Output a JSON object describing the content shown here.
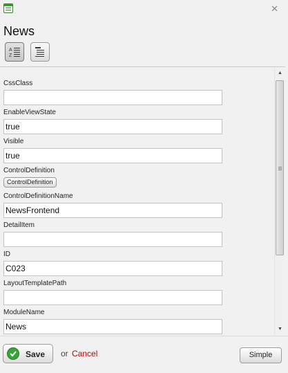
{
  "window": {
    "title": "News",
    "app_icon": "form-icon",
    "close_icon": "close-icon",
    "close_glyph": "✕"
  },
  "toolbar": {
    "sort_alpha_icon": "sort-alphabetical-icon",
    "sort_category_icon": "categorized-list-icon"
  },
  "properties": [
    {
      "label": "CssClass",
      "type": "input",
      "value": ""
    },
    {
      "label": "EnableViewState",
      "type": "input",
      "value": "true"
    },
    {
      "label": "Visible",
      "type": "input",
      "value": "true"
    },
    {
      "label": "ControlDefinition",
      "type": "button",
      "value": "ControlDefinition"
    },
    {
      "label": "ControlDefinitionName",
      "type": "input",
      "value": "NewsFrontend"
    },
    {
      "label": "DetailItem",
      "type": "input",
      "value": ""
    },
    {
      "label": "ID",
      "type": "input",
      "value": "C023"
    },
    {
      "label": "LayoutTemplatePath",
      "type": "input",
      "value": ""
    },
    {
      "label": "ModuleName",
      "type": "input",
      "value": "News"
    }
  ],
  "scrollbar": {
    "up_glyph": "▲",
    "down_glyph": "▼"
  },
  "footer": {
    "save_label": "Save",
    "save_icon": "checkmark-icon",
    "or_text": "or",
    "cancel_label": "Cancel",
    "simple_label": "Simple"
  },
  "colors": {
    "background": "#f1f1f1",
    "cancel_link": "#c00000",
    "save_check": "#37a437"
  }
}
